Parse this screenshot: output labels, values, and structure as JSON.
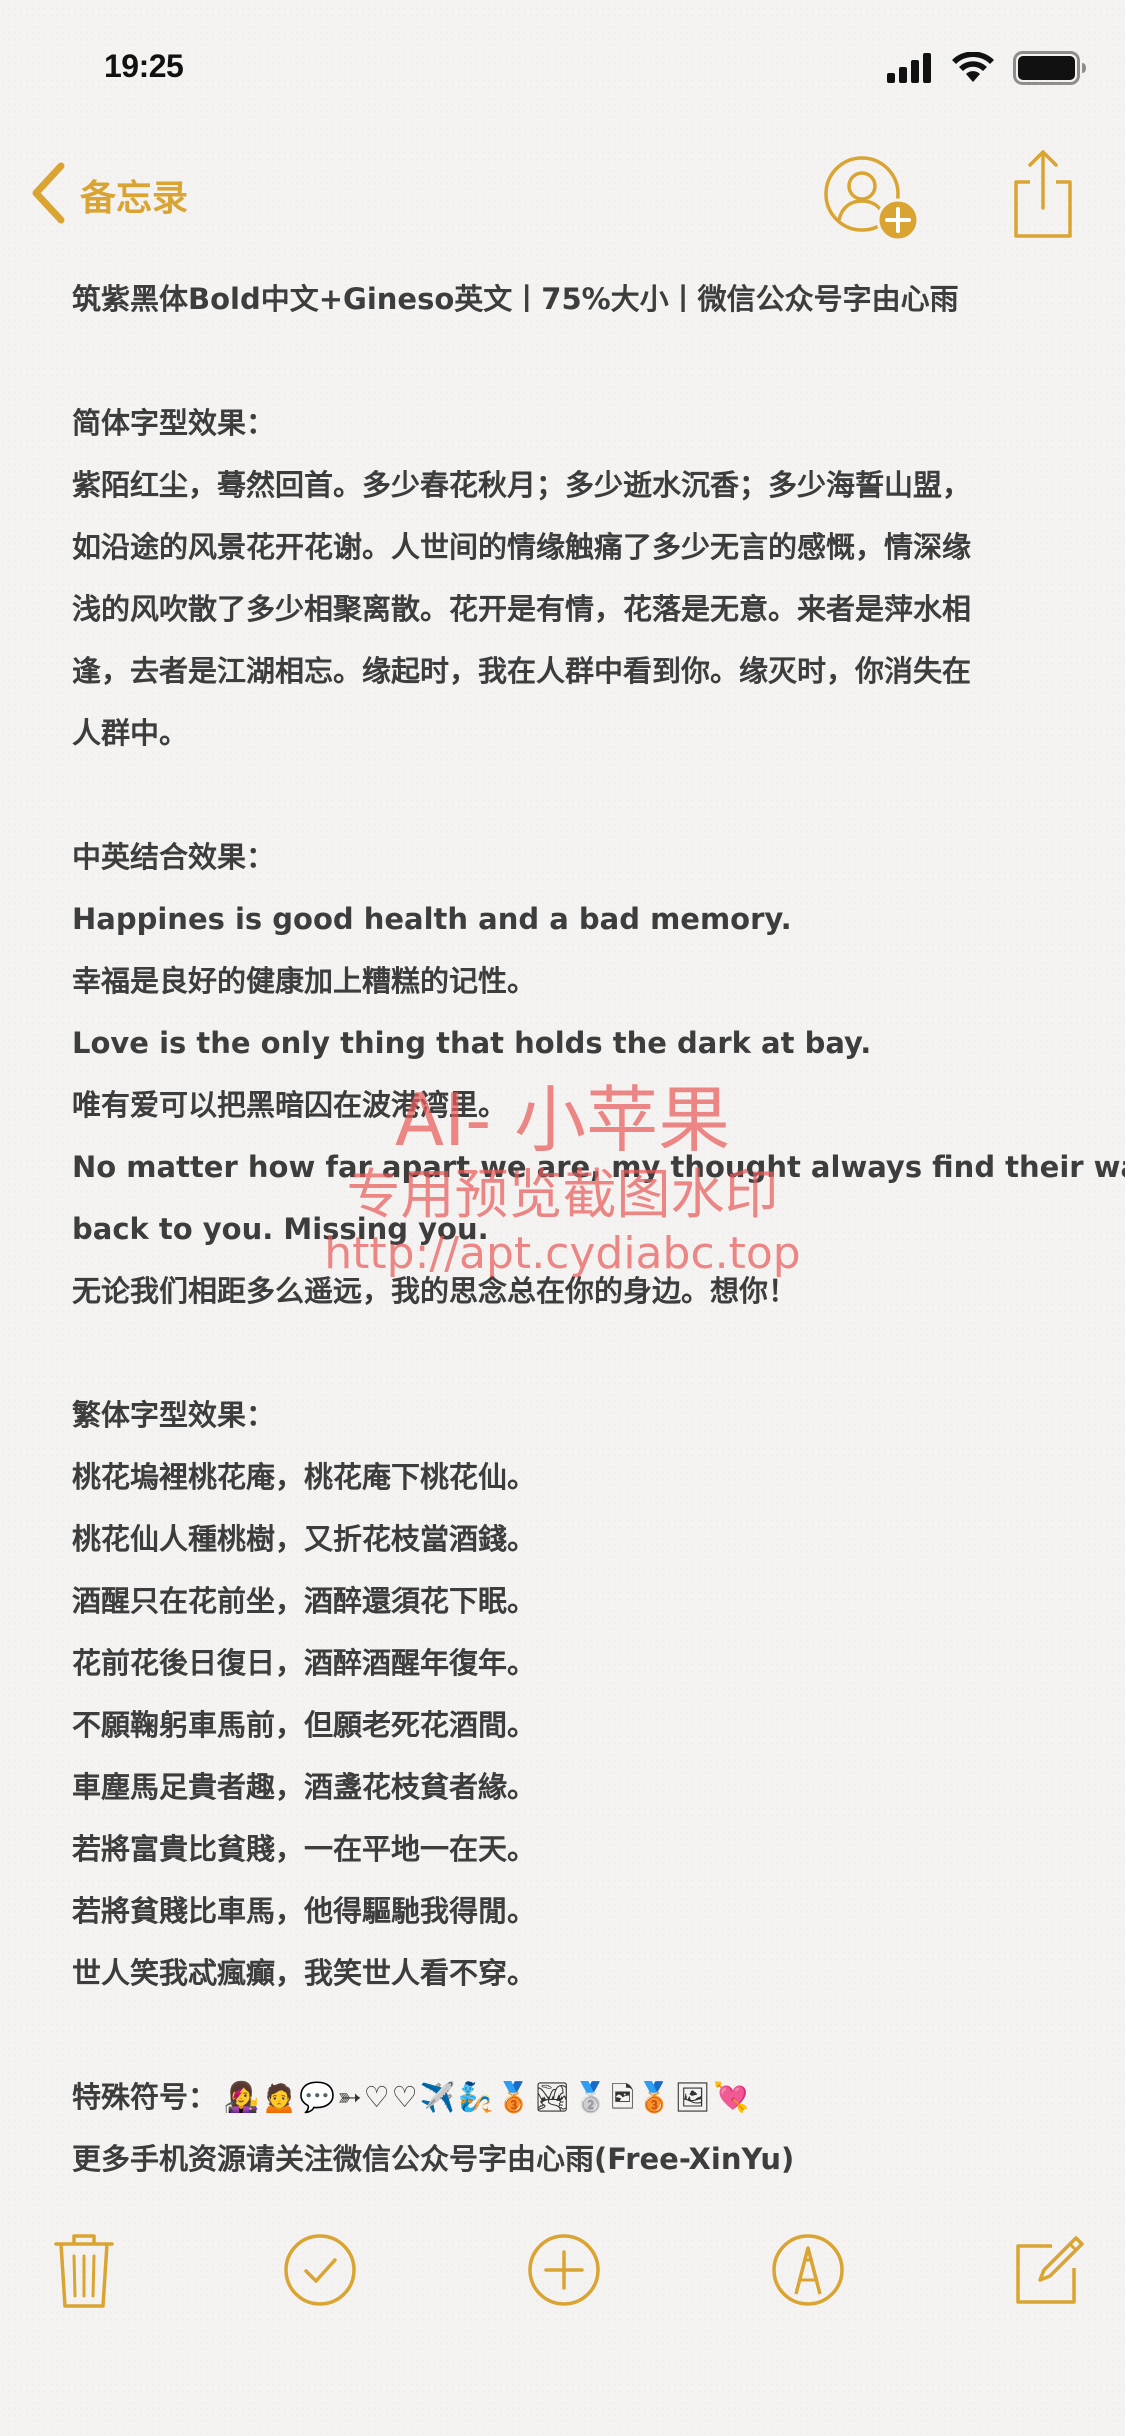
{
  "status_bar": {
    "time": "19:25"
  },
  "nav": {
    "back_label": "备忘录",
    "accent_color": "#d9a432"
  },
  "note": {
    "lines": [
      "筑紫黑体Bold中文+Gineso英文丨75%大小丨微信公众号字由心雨",
      "",
      "简体字型效果：",
      "紫陌红尘，蓦然回首。多少春花秋月；多少逝水沉香；多少海誓山盟，",
      "如沿途的风景花开花谢。人世间的情缘触痛了多少无言的感慨，情深缘",
      "浅的风吹散了多少相聚离散。花开是有情，花落是无意。来者是萍水相",
      "逢，去者是江湖相忘。缘起时，我在人群中看到你。缘灭时，你消失在",
      "人群中。",
      "",
      "中英结合效果：",
      "Happines is good health and a bad memory.",
      "幸福是良好的健康加上糟糕的记性。",
      "Love is the only thing that holds the dark at bay.",
      "唯有爱可以把黑暗囚在波港湾里。",
      "No matter how far apart we are, my thought always find their way",
      "back to you. Missing you.",
      "无论我们相距多么遥远，我的思念总在你的身边。想你！",
      "",
      "繁体字型效果：",
      "桃花塢裡桃花庵，桃花庵下桃花仙。",
      "桃花仙人種桃樹，又折花枝當酒錢。",
      "酒醒只在花前坐，酒醉還須花下眠。",
      "花前花後日復日，酒醉酒醒年復年。",
      "不願鞠躬車馬前，但願老死花酒間。",
      "車塵馬足貴者趣，酒盞花枝貧者緣。",
      "若將富貴比貧賤，一在平地一在天。",
      "若將貧賤比車馬，他得驅馳我得閒。",
      "世人笑我忒瘋癲，我笑世人看不穿。",
      ""
    ],
    "symbols_label": "特殊符号：",
    "symbols": "👩‍🎤🙍💬➳♡♡✈️🧞🥉🏞🥈🖻🥉🖼💘",
    "footer_line": "更多手机资源请关注微信公众号字由心雨(Free-XinYu)"
  },
  "watermark": {
    "line1": "AI- 小苹果",
    "line2": "专用预览截图水印",
    "line3": "http://apt.cydiabc.top"
  },
  "toolbar": {
    "icons": [
      "trash-icon",
      "checklist-icon",
      "add-icon",
      "markup-icon",
      "compose-icon"
    ]
  }
}
